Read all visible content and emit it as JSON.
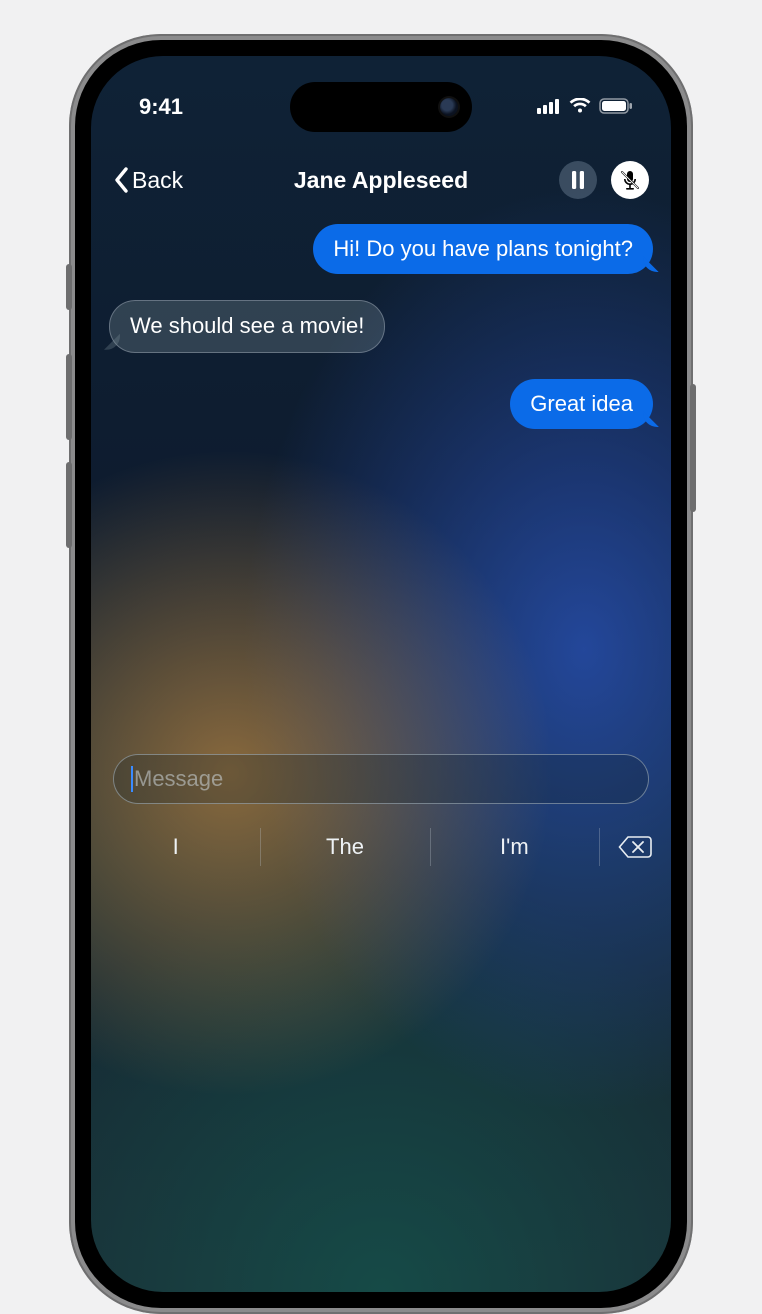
{
  "status": {
    "time": "9:41"
  },
  "nav": {
    "back_label": "Back",
    "title": "Jane Appleseed"
  },
  "messages": [
    {
      "side": "sent",
      "text": "Hi! Do you have plans tonight?"
    },
    {
      "side": "recv",
      "text": "We should see a movie!"
    },
    {
      "side": "sent",
      "text": "Great idea"
    }
  ],
  "composer": {
    "placeholder": "Message"
  },
  "suggestions": [
    "I",
    "The",
    "I'm"
  ]
}
